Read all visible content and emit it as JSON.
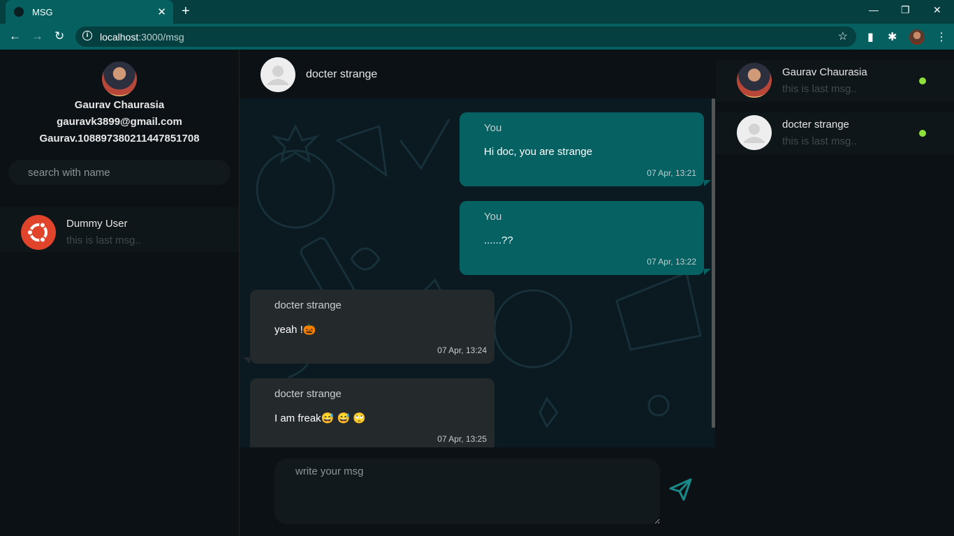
{
  "browser": {
    "tab_title": "MSG",
    "tab_close": "✕",
    "new_tab": "+",
    "url_host": "localhost",
    "url_rest": ":3000/msg",
    "controls": {
      "minimize": "—",
      "restore": "❐",
      "close": "✕"
    }
  },
  "profile": {
    "name": "Gaurav Chaurasia",
    "email": "gauravk3899@gmail.com",
    "id": "Gaurav.108897380211447851708"
  },
  "search": {
    "placeholder": "search with name"
  },
  "contacts": [
    {
      "name": "Dummy User",
      "last": "this is last msg.."
    }
  ],
  "chat": {
    "contact_name": "docter strange",
    "messages": [
      {
        "who": "You",
        "text": "Hi doc, you are strange",
        "time": "07 Apr, 13:21",
        "dir": "out"
      },
      {
        "who": "You",
        "text": "......??",
        "time": "07 Apr, 13:22",
        "dir": "out"
      },
      {
        "who": "docter strange",
        "text": "yeah !🎃",
        "time": "07 Apr, 13:24",
        "dir": "in"
      },
      {
        "who": "docter strange",
        "text": "I am freak😅 😅 🙄",
        "time": "07 Apr, 13:25",
        "dir": "in"
      }
    ],
    "composer_placeholder": "write your msg"
  },
  "online": [
    {
      "name": "Gaurav Chaurasia",
      "last": "this is last msg..",
      "status": "online"
    },
    {
      "name": "docter strange",
      "last": "this is last msg..",
      "status": "online"
    }
  ],
  "colors": {
    "accent": "#056162",
    "chrome": "#066060",
    "online_dot": "#8ee03a",
    "incoming": "#24292c"
  }
}
